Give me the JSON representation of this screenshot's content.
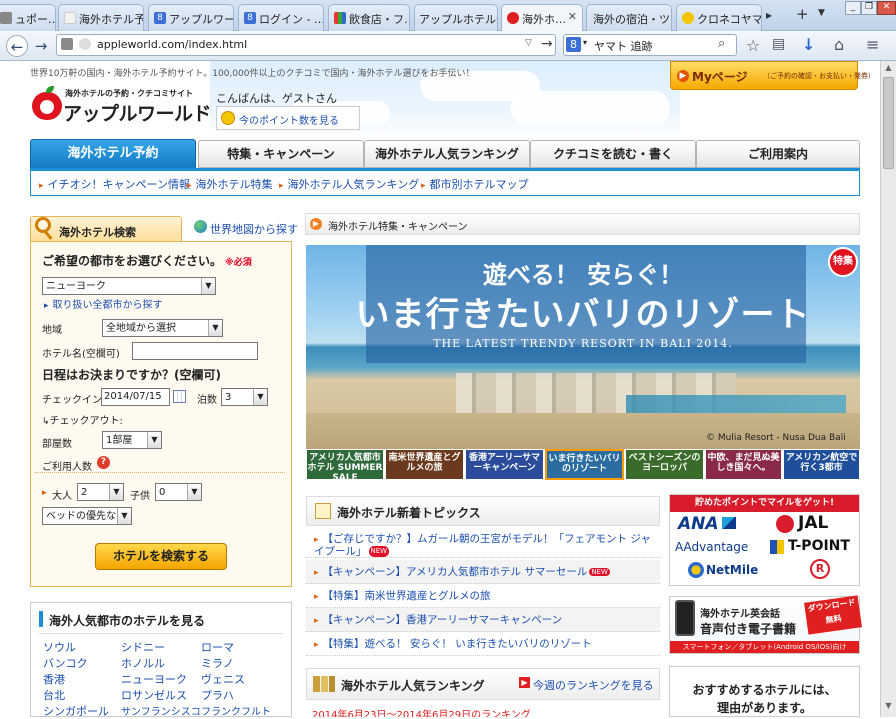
{
  "browser": {
    "tabs": [
      {
        "label": "ュポー…",
        "active": false
      },
      {
        "label": "海外ホテル予…",
        "active": false
      },
      {
        "label": "アップルワー…",
        "active": false
      },
      {
        "label": "ログイン - …",
        "active": false
      },
      {
        "label": "飲食店・フ…",
        "active": false
      },
      {
        "label": "アップルホテル予…",
        "active": false
      },
      {
        "label": "海外ホ…",
        "active": true
      },
      {
        "label": "海外の宿泊・ツ…",
        "active": false
      },
      {
        "label": "クロネコヤマ…",
        "active": false
      }
    ],
    "url": "appleworld.com/index.html",
    "search_engine": "8",
    "search_text": "ヤマト 追跡",
    "colors": {
      "chrome": "#cddced",
      "accent": "#1e8fd6"
    }
  },
  "site": {
    "tagline": "世界10万軒の国内・海外ホテル予約サイト。100,000件以上のクチコミで国内・海外ホテル選びをお手伝い！",
    "logo_sub": "海外ホテルの予約・クチコミサイト",
    "logo_main": "アップルワールド",
    "greeting": "こんばんは、ゲストさん",
    "points_link": "今のポイント数を見る",
    "mypage_label": "Myページ",
    "mypage_sub": "（ご予約の確認・お支払い・発券）"
  },
  "main_nav": [
    {
      "label": "海外ホテル予約",
      "active": true
    },
    {
      "label": "特集・キャンペーン",
      "active": false
    },
    {
      "label": "海外ホテル人気ランキング",
      "active": false
    },
    {
      "label": "クチコミを読む・書く",
      "active": false
    },
    {
      "label": "ご利用案内",
      "active": false
    }
  ],
  "sub_nav": [
    "イチオシ！キャンペーン情報",
    "海外ホテル特集",
    "海外ホテル人気ランキング",
    "都市別ホテルマップ"
  ],
  "search_panel": {
    "title": "海外ホテル検索",
    "map_link": "世界地図から探す",
    "city_heading": "ご希望の都市をお選びください。",
    "required": "※必須",
    "city_value": "ニューヨーク",
    "city_link": "取り扱い全都市から探す",
    "area_label": "地域",
    "area_value": "全地域から選択",
    "hotel_label": "ホテル名(空欄可)",
    "hotel_value": "",
    "date_heading": "日程はお決まりですか？(空欄可)",
    "checkin_label": "チェックイン",
    "checkin_value": "2014/07/15",
    "nights_label": "泊数",
    "nights_value": "3",
    "checkout_label": "チェックアウト:",
    "rooms_label": "部屋数",
    "rooms_value": "1部屋",
    "guests_label": "ご利用人数",
    "adults_label": "大人",
    "adults_value": "2",
    "children_label": "子供",
    "children_value": "0",
    "bed_value": "ベッドの優先なし",
    "search_button": "ホテルを検索する"
  },
  "popular_cities": {
    "title": "海外人気都市のホテルを見る",
    "col1": [
      "ソウル",
      "バンコク",
      "香港",
      "台北",
      "シンガポール"
    ],
    "col2": [
      "シドニー",
      "ホノルル",
      "ニューヨーク",
      "ロサンゼルス",
      "サンフランシスコ"
    ],
    "col3": [
      "ローマ",
      "ミラノ",
      "ヴェニス",
      "プラハ",
      "フランクフルト"
    ]
  },
  "feature": {
    "header": "海外ホテル特集・キャンペーン",
    "banner_line1": "遊べる！ 安らぐ！",
    "banner_line2": "いま行きたいバリのリゾート",
    "banner_line3": "THE LATEST TRENDY RESORT IN BALI 2014.",
    "badge": "特集",
    "credit": "© Mulia Resort - Nusa Dua Bali",
    "thumbs": [
      {
        "text": "アメリカ人気都市ホテル SUMMER SALE",
        "color": "#2e6a3a"
      },
      {
        "text": "南米世界遺産とグルメの旅",
        "color": "#6b3a1e"
      },
      {
        "text": "香港アーリーサマーキャンペーン",
        "color": "#2a4c9a"
      },
      {
        "text": "いま行きたいバリのリゾート",
        "color": "#2b6da0"
      },
      {
        "text": "ベストシーズンのヨーロッパ",
        "color": "#3a6b2a"
      },
      {
        "text": "中欧、まだ見ぬ美しき国々へ。",
        "color": "#8a2a4a"
      },
      {
        "text": "アメリカン航空で行く3都市",
        "color": "#1f4f9a"
      }
    ]
  },
  "topics": {
    "title": "海外ホテル新着トピックス",
    "items": [
      {
        "text": "【ご存じですか？】ムガール朝の王宮がモデル！「フェアモント ジャイプール」",
        "new": "NEW"
      },
      {
        "text": "【キャンペーン】アメリカ人気都市ホテル サマーセール",
        "new": "NEW"
      },
      {
        "text": "【特集】南米世界遺産とグルメの旅",
        "new": ""
      },
      {
        "text": "【キャンペーン】香港アーリーサマーキャンペーン",
        "new": ""
      },
      {
        "text": "【特集】遊べる！ 安らぐ！ いま行きたいバリのリゾート",
        "new": ""
      }
    ]
  },
  "ranking": {
    "title": "海外ホテル人気ランキング",
    "link": "今週のランキングを見る",
    "period": "2014年6月23日～2014年6月29日のランキング"
  },
  "ads": {
    "mile_title": "貯めたポイントでマイルをゲット!",
    "mile_brands": [
      "ANA",
      "JAL",
      "AAdvantage",
      "T-POINT",
      "NetMile",
      "R"
    ],
    "ebook_title1": "海外ホテル英会話",
    "ebook_title2": "音声付き電子書籍",
    "ebook_badge": "ダウンロード無料",
    "ebook_foot": "スマートフォン／タブレット(Android OS/iOS)向け",
    "recommend_line1": "おすすめするホテルには、",
    "recommend_line2": "理由があります。"
  }
}
